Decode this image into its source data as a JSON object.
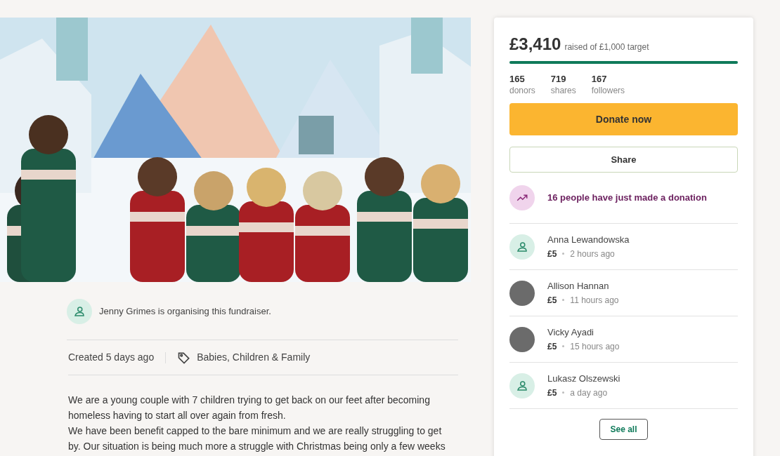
{
  "organiser": {
    "text": "Jenny Grimes is organising this fundraiser."
  },
  "meta": {
    "created": "Created 5 days ago",
    "category": "Babies, Children & Family"
  },
  "story": [
    "We are a young couple with 7 children trying to get back on our feet after becoming homeless having to start all over again from fresh.",
    "We have been benefit capped to the bare minimum and we are really struggling to get by. Our situation is being much more a struggle with Christmas being only a few weeks"
  ],
  "sidebar": {
    "amount": "£3,410",
    "raised_text": "raised of £1,000 target",
    "progress": {
      "level": 1
    },
    "stats": [
      {
        "value": "165",
        "label": "donors"
      },
      {
        "value": "719",
        "label": "shares"
      },
      {
        "value": "167",
        "label": "followers"
      }
    ],
    "donate_button": "Donate now",
    "share_button": "Share",
    "trending": "16 people have just made a donation",
    "donations": [
      {
        "name": "Anna Lewandowska",
        "amount": "£5",
        "time": "2 hours ago",
        "kind": "icon"
      },
      {
        "name": "Allison Hannan",
        "amount": "£5",
        "time": "11 hours ago",
        "kind": "photo"
      },
      {
        "name": "Vicky Ayadi",
        "amount": "£5",
        "time": "15 hours ago",
        "kind": "photo"
      },
      {
        "name": "Lukasz Olszewski",
        "amount": "£5",
        "time": "a day ago",
        "kind": "icon"
      }
    ],
    "see_all": "See all"
  }
}
